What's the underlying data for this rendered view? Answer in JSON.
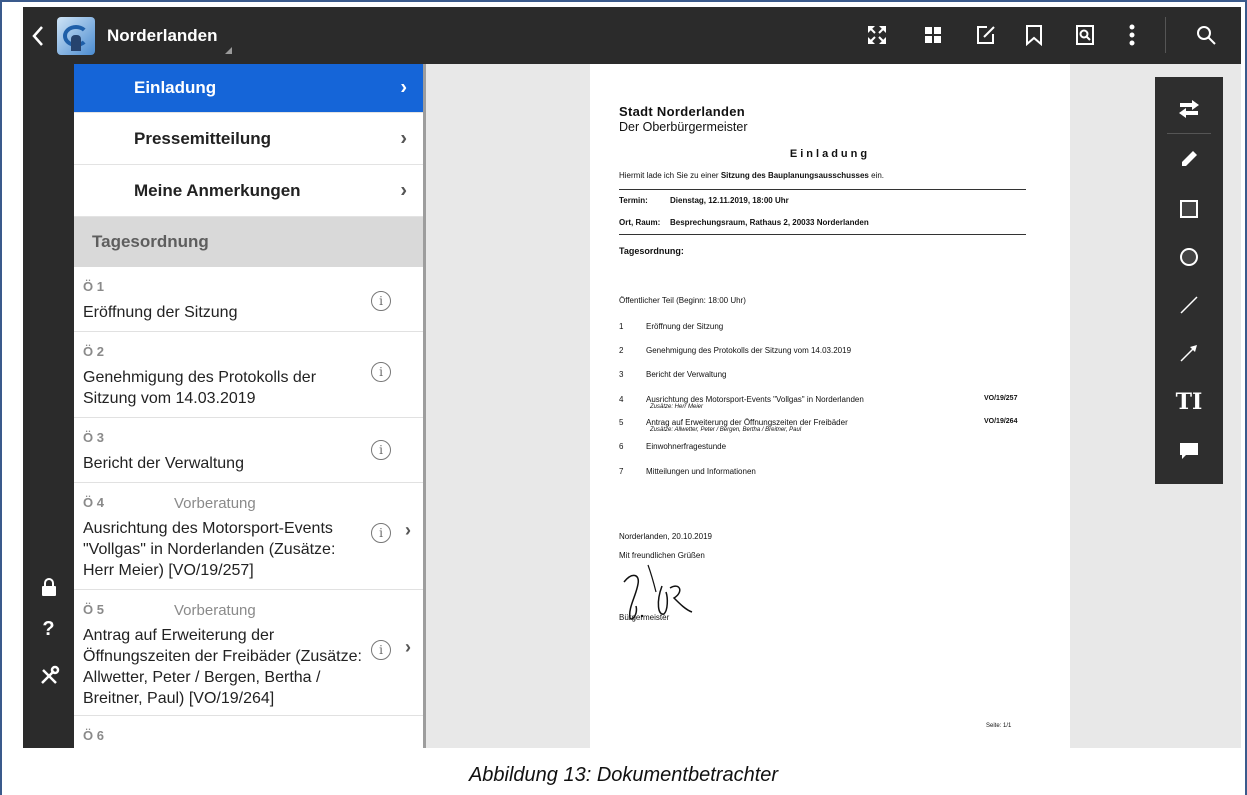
{
  "app": {
    "title": "Norderlanden"
  },
  "toolbar_icons": [
    "fullscreen-icon",
    "grid-icon",
    "edit-note-icon",
    "bookmark-icon",
    "search-document-icon",
    "more-vert-icon",
    "search-icon"
  ],
  "rail_icons": [
    "lock-icon",
    "help-icon",
    "tools-icon"
  ],
  "nav": [
    {
      "label": "Einladung",
      "active": true
    },
    {
      "label": "Pressemitteilung",
      "active": false
    },
    {
      "label": "Meine Anmerkungen",
      "active": false
    }
  ],
  "agenda": {
    "header": "Tagesordnung",
    "items": [
      {
        "num": "Ö 1",
        "status": "",
        "title": "Eröffnung der Sitzung",
        "has_chevron": false
      },
      {
        "num": "Ö 2",
        "status": "",
        "title": "Genehmigung des Protokolls der Sitzung vom 14.03.2019",
        "has_chevron": false
      },
      {
        "num": "Ö 3",
        "status": "",
        "title": "Bericht der Verwaltung",
        "has_chevron": false
      },
      {
        "num": "Ö 4",
        "status": "Vorberatung",
        "title": "Ausrichtung des Motorsport-Events \"Vollgas\" in Norderlanden (Zusätze: Herr Meier) [VO/19/257]",
        "has_chevron": true
      },
      {
        "num": "Ö 5",
        "status": "Vorberatung",
        "title": "Antrag auf Erweiterung der Öffnungszeiten der Freibäder (Zusätze: Allwetter, Peter / Bergen, Bertha / Breitner, Paul) [VO/19/264]",
        "has_chevron": true
      },
      {
        "num": "Ö 6",
        "status": "",
        "title": "",
        "has_chevron": false
      }
    ]
  },
  "document": {
    "org": "Stadt Norderlanden",
    "office": "Der Oberbürgermeister",
    "heading": "Einladung",
    "intro_pre": "Hiermit lade ich Sie zu einer ",
    "intro_bold": "Sitzung des Bauplanungsausschusses",
    "intro_post": " ein.",
    "termin_label": "Termin:",
    "termin_value": "Dienstag, 12.11.2019, 18:00 Uhr",
    "ort_label": "Ort, Raum:",
    "ort_value": "Besprechungsraum, Rathaus 2, 20033 Norderlanden",
    "tagesordnung": "Tagesordnung:",
    "public_part": "Öffentlicher Teil (Beginn: 18:00 Uhr)",
    "items": [
      {
        "num": "1",
        "text": "Eröffnung der Sitzung",
        "sub": "",
        "vo": ""
      },
      {
        "num": "2",
        "text": "Genehmigung des Protokolls der Sitzung vom 14.03.2019",
        "sub": "",
        "vo": ""
      },
      {
        "num": "3",
        "text": "Bericht der Verwaltung",
        "sub": "",
        "vo": ""
      },
      {
        "num": "4",
        "text": "Ausrichtung des Motorsport-Events \"Vollgas\" in Norderlanden",
        "sub": "Zusätze: Herr Meier",
        "vo": "VO/19/257"
      },
      {
        "num": "5",
        "text": "Antrag auf Erweiterung der Öffnungszeiten der Freibäder",
        "sub": "Zusätze: Allwetter, Peter / Bergen, Bertha / Breitner, Paul",
        "vo": "VO/19/264"
      },
      {
        "num": "6",
        "text": "Einwohnerfragestunde",
        "sub": "",
        "vo": ""
      },
      {
        "num": "7",
        "text": "Mitteilungen und Informationen",
        "sub": "",
        "vo": ""
      }
    ],
    "place_date": "Norderlanden, 20.10.2019",
    "greeting": "Mit freundlichen Grüßen",
    "signer": "Bürgermeister",
    "page_label": "Seite: 1/1"
  },
  "annotation_tools": [
    "swap-icon",
    "pencil-icon",
    "rectangle-icon",
    "circle-icon",
    "line-icon",
    "arrow-icon",
    "text-icon",
    "comment-icon"
  ],
  "annotation_text_tool_label": "TI",
  "caption": "Abbildung 13: Dokumentbetrachter",
  "colors": {
    "accent": "#1565d8",
    "toolbar": "#2b2b2b"
  }
}
